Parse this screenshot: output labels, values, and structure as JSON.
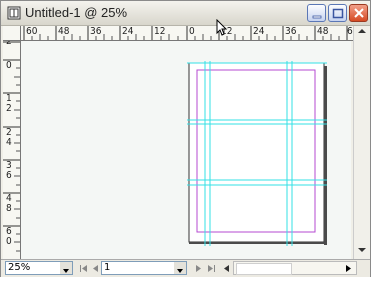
{
  "window": {
    "title": "Untitled-1 @ 25%",
    "icons": {
      "app": "indesign-doc-icon",
      "minimize": "minimize-icon",
      "maximize": "maximize-icon",
      "close": "close-icon"
    },
    "colors": {
      "close": "#d54a23",
      "guides": "#33e0e6",
      "margins": "#b64ad2"
    }
  },
  "ruler_top": {
    "labels": [
      "60",
      "48",
      "36",
      "24",
      "12",
      "0",
      "12",
      "24",
      "36",
      "48",
      "6"
    ]
  },
  "ruler_left": {
    "labels": [
      "2",
      "0",
      "1 2",
      "2 4",
      "3 6",
      "4 8",
      "6 0"
    ]
  },
  "statusbar": {
    "zoom_value": "25%",
    "page_value": "1",
    "nav_icons": [
      "first-page-icon",
      "prev-page-icon",
      "next-page-icon",
      "last-page-icon"
    ]
  }
}
